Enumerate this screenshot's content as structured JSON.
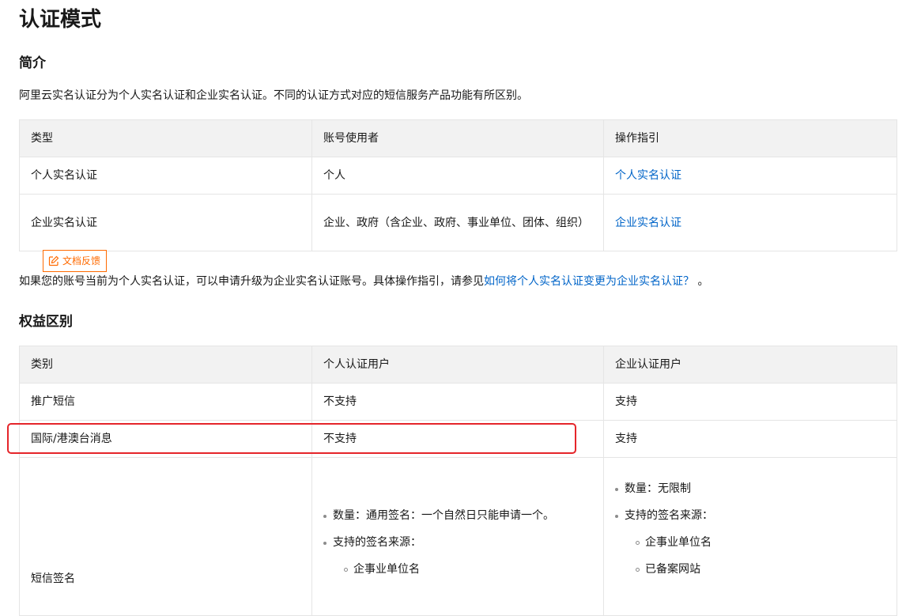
{
  "page_title": "认证模式",
  "intro": {
    "heading": "简介",
    "paragraph": "阿里云实名认证分为个人实名认证和企业实名认证。不同的认证方式对应的短信服务产品功能有所区别。",
    "table": {
      "headers": [
        "类型",
        "账号使用者",
        "操作指引"
      ],
      "rows": [
        {
          "type": "个人实名认证",
          "user": "个人",
          "guide": "个人实名认证"
        },
        {
          "type": "企业实名认证",
          "user": "企业、政府（含企业、政府、事业单位、团体、组织）",
          "guide": "企业实名认证"
        }
      ]
    },
    "feedback_label": "文档反馈",
    "upgrade_text_before": "如果您的账号当前为个人实名认证，可以申请升级为企业实名认证账号。具体操作指引，请参见",
    "upgrade_link": "如何将个人实名认证变更为企业实名认证？",
    "upgrade_text_after": " 。"
  },
  "benefits": {
    "heading": "权益区别",
    "table": {
      "headers": [
        "类别",
        "个人认证用户",
        "企业认证用户"
      ],
      "rows": [
        {
          "category": "推广短信",
          "personal": "不支持",
          "enterprise": "支持"
        },
        {
          "category": "国际/港澳台消息",
          "personal": "不支持",
          "enterprise": "支持"
        }
      ],
      "signature_row": {
        "category": "短信签名",
        "personal": {
          "quantity": "数量：通用签名：一个自然日只能申请一个。",
          "sources_label": "支持的签名来源：",
          "sources": [
            "企事业单位名"
          ]
        },
        "enterprise": {
          "quantity": "数量：无限制",
          "sources_label": "支持的签名来源：",
          "sources": [
            "企事业单位名",
            "已备案网站"
          ]
        }
      }
    }
  },
  "colors": {
    "link": "#0064c8",
    "feedback": "#ff6a00",
    "highlight": "#e5252a",
    "header_bg": "#f2f2f2",
    "border": "#e5e5e5"
  }
}
